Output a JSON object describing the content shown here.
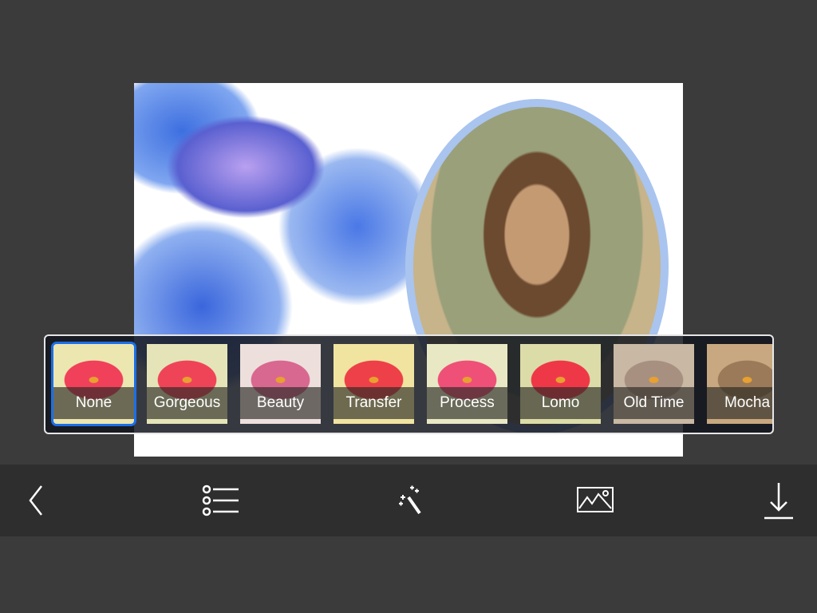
{
  "filters": [
    {
      "label": "None",
      "selected": true,
      "tint": "#ece6b0",
      "petal": "#f0405a"
    },
    {
      "label": "Gorgeous",
      "selected": false,
      "tint": "#e4e4b8",
      "petal": "#ef4458"
    },
    {
      "label": "Beauty",
      "selected": false,
      "tint": "#ede0dc",
      "petal": "#d86890"
    },
    {
      "label": "Transfer",
      "selected": false,
      "tint": "#f0e4a0",
      "petal": "#ee4048"
    },
    {
      "label": "Process",
      "selected": false,
      "tint": "#e8e8c4",
      "petal": "#ee5078"
    },
    {
      "label": "Lomo",
      "selected": false,
      "tint": "#dcdca8",
      "petal": "#ee3848"
    },
    {
      "label": "Old Time",
      "selected": false,
      "tint": "#c8b8a4",
      "petal": "#a89080"
    },
    {
      "label": "Mocha",
      "selected": false,
      "tint": "#c8a880",
      "petal": "#9a7a58"
    }
  ],
  "toolbar": {
    "items": [
      "back-icon",
      "list-icon",
      "magic-wand-icon",
      "image-icon",
      "download-icon"
    ]
  },
  "colors": {
    "accent": "#1a6fe8",
    "toolbar": "#2e2e2e",
    "background": "#3b3b3b"
  }
}
